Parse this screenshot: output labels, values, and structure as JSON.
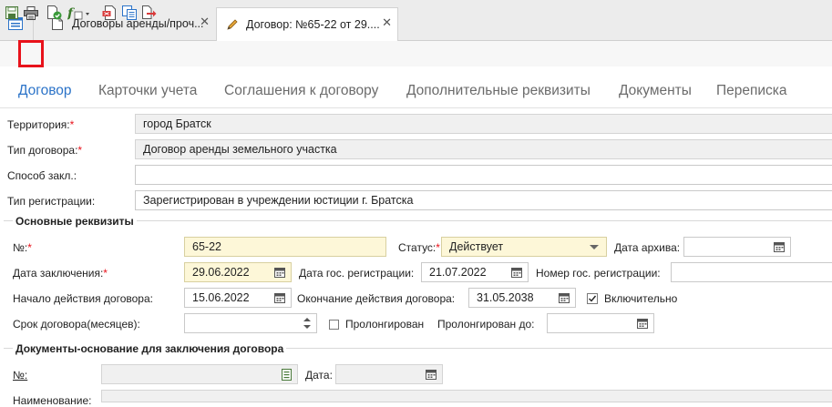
{
  "tabs": [
    {
      "label": "Договоры аренды/проч...",
      "icon": "document-icon"
    },
    {
      "label": "Договор: №65-22 от 29....",
      "icon": "pencil-icon"
    }
  ],
  "close_symbol": "✕",
  "nav": [
    "Договор",
    "Карточки учета",
    "Соглашения к договору",
    "Дополнительные реквизиты",
    "Документы",
    "Переписка"
  ],
  "form": {
    "territory": {
      "label": "Территория:",
      "value": "город Братск"
    },
    "contract_type": {
      "label": "Тип договора:",
      "value": "Договор аренды земельного участка"
    },
    "conclusion_method": {
      "label": "Способ закл.:",
      "value": ""
    },
    "registration_type": {
      "label": "Тип регистрации:",
      "value": "Зарегистрирован в учреждении юстиции г. Братска"
    }
  },
  "main": {
    "title": "Основные реквизиты",
    "number": {
      "label": "№:",
      "value": "65-22"
    },
    "status": {
      "label": "Статус:",
      "value": "Действует"
    },
    "archive_date": {
      "label": "Дата архива:",
      "value": ""
    },
    "conclusion_date": {
      "label": "Дата заключения:",
      "value": "29.06.2022"
    },
    "state_reg_date": {
      "label": "Дата гос. регистрации:",
      "value": "21.07.2022"
    },
    "state_reg_number": {
      "label": "Номер гос. регистрации:",
      "value": ""
    },
    "start_date": {
      "label": "Начало действия договора:",
      "value": "15.06.2022"
    },
    "end_date": {
      "label": "Окончание действия договора:",
      "value": "31.05.2038"
    },
    "inclusive": {
      "label": "Включительно",
      "checked": true
    },
    "term": {
      "label": "Срок договора(месяцев):",
      "value": ""
    },
    "prolonged": {
      "label": "Пролонгирован",
      "checked": false
    },
    "prolonged_until": {
      "label": "Пролонгирован до:",
      "value": ""
    }
  },
  "docs": {
    "title": "Документы-основание для заключения договора",
    "number": {
      "label": "№:",
      "value": ""
    },
    "date": {
      "label": "Дата:",
      "value": ""
    },
    "name": {
      "label": "Наименование:",
      "value": ""
    }
  },
  "required_mark": "*",
  "colors": {
    "accent": "#2b73c8",
    "highlight": "#e8121b",
    "required": "#e8121b",
    "yellow_field": "#fdf7d8"
  }
}
